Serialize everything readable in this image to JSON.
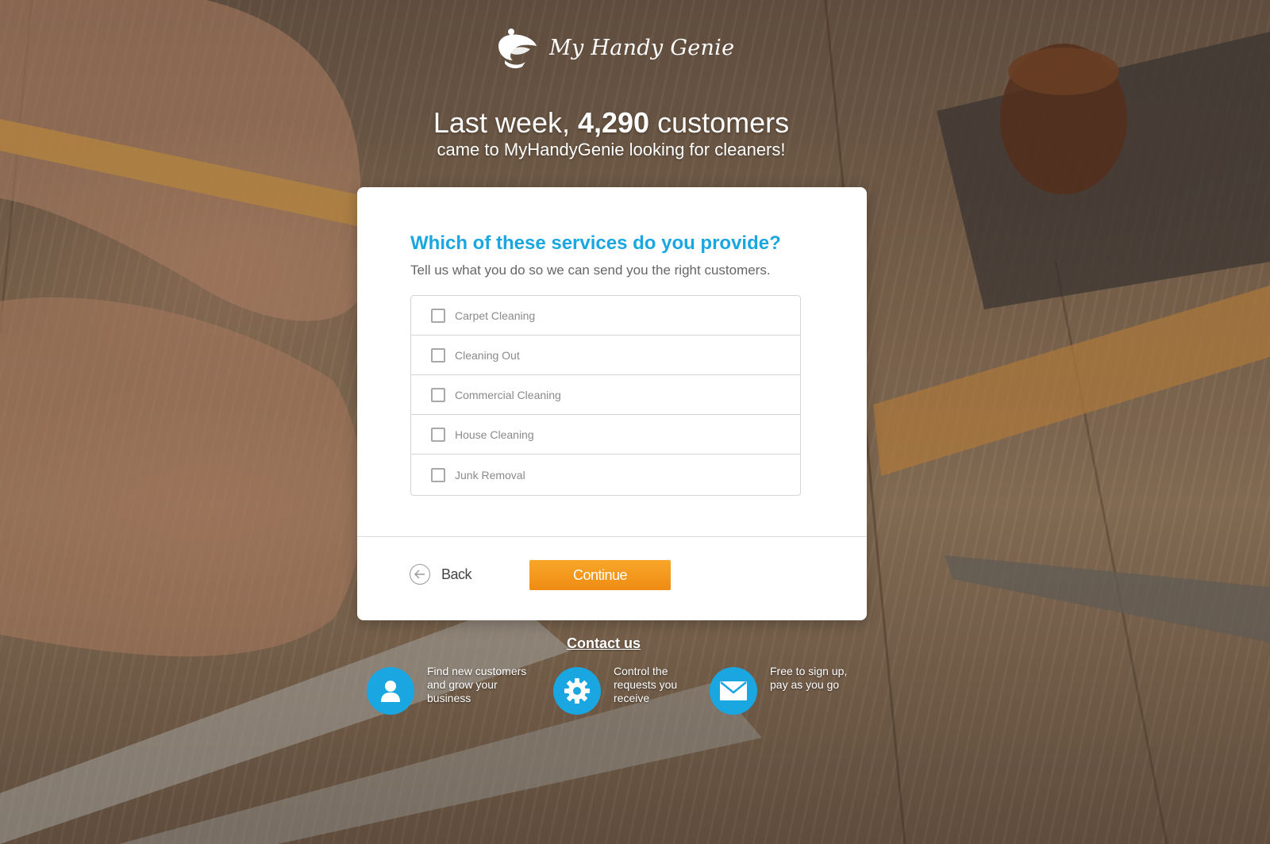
{
  "brand": {
    "name": "My Handy Genie",
    "accent": "#1aa6e0",
    "cta": "#f39314"
  },
  "hero": {
    "line1_prefix": "Last week, ",
    "line1_count": "4,290",
    "line1_suffix": " customers",
    "line2": "came to MyHandyGenie looking for cleaners!"
  },
  "card": {
    "question": "Which of these services do you provide?",
    "subtitle": "Tell us what you do so we can send you the right customers.",
    "services": [
      {
        "label": "Carpet Cleaning",
        "checked": false
      },
      {
        "label": "Cleaning Out",
        "checked": false
      },
      {
        "label": "Commercial Cleaning",
        "checked": false
      },
      {
        "label": "House Cleaning",
        "checked": false
      },
      {
        "label": "Junk Removal",
        "checked": false
      }
    ],
    "back_label": "Back",
    "continue_label": "Continue"
  },
  "footer": {
    "contact_label": "Contact us",
    "features": [
      {
        "icon": "person-icon",
        "lines": [
          "Find new customers",
          "and grow your",
          "business"
        ]
      },
      {
        "icon": "gear-icon",
        "lines": [
          "Control the",
          "requests you",
          "receive"
        ]
      },
      {
        "icon": "envelope-icon",
        "lines": [
          "Free to sign up,",
          "pay as you go"
        ]
      }
    ]
  }
}
